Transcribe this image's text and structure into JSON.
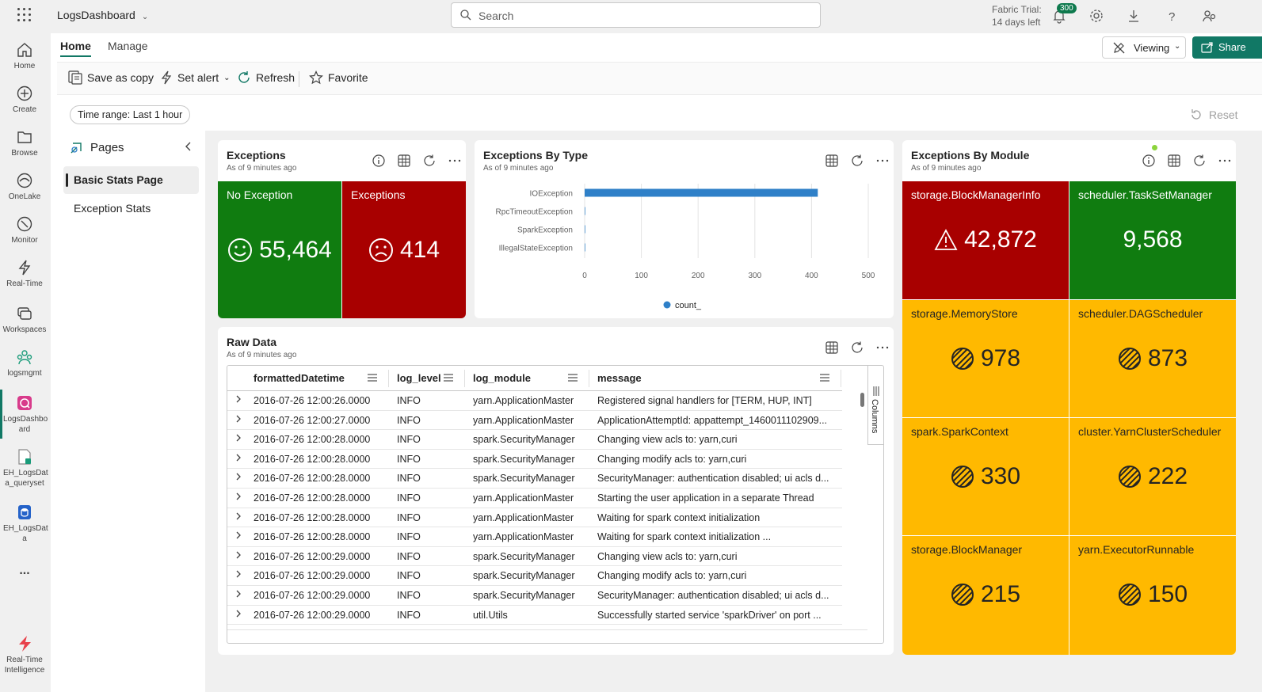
{
  "app": {
    "title": "LogsDashboard",
    "search_placeholder": "Search",
    "trial_line1": "Fabric Trial:",
    "trial_line2": "14 days left",
    "notifications_count": "300"
  },
  "rail": [
    {
      "label": "Home",
      "icon": "home-icon"
    },
    {
      "label": "Create",
      "icon": "create-icon"
    },
    {
      "label": "Browse",
      "icon": "browse-icon"
    },
    {
      "label": "OneLake",
      "icon": "onelake-icon"
    },
    {
      "label": "Monitor",
      "icon": "monitor-icon"
    },
    {
      "label": "Real-Time",
      "icon": "realtime-icon"
    },
    {
      "label": "Workspaces",
      "icon": "workspaces-icon"
    },
    {
      "label": "logsmgmt",
      "icon": "workspace-people-icon"
    },
    {
      "label": "LogsDashbo ard",
      "icon": "dashboard-icon"
    },
    {
      "label": "EH_LogsDat a_queryset",
      "icon": "queryset-icon"
    },
    {
      "label": "EH_LogsDat a",
      "icon": "database-icon"
    },
    {
      "label": "...",
      "icon": "more-icon"
    },
    {
      "label": "Real-Time Intelligence",
      "icon": "rti-icon"
    }
  ],
  "tabs": [
    {
      "label": "Home"
    },
    {
      "label": "Manage"
    }
  ],
  "header_buttons": {
    "viewing": "Viewing",
    "share": "Share"
  },
  "toolbar": {
    "save_as_copy": "Save as copy",
    "set_alert": "Set alert",
    "refresh": "Refresh",
    "favorite": "Favorite"
  },
  "filters": {
    "time_range_label": "Time range:",
    "time_range_value": "Last 1 hour",
    "reset": "Reset"
  },
  "pages_pane": {
    "title": "Pages",
    "items": [
      {
        "label": "Basic Stats Page",
        "active": true
      },
      {
        "label": "Exception Stats",
        "active": false
      }
    ]
  },
  "tiles": {
    "exceptions": {
      "title": "Exceptions",
      "subtitle": "As of 9 minutes ago",
      "stats": [
        {
          "name": "No Exception",
          "value": "55,464",
          "color": "#107c10",
          "icon": "smile-icon"
        },
        {
          "name": "Exceptions",
          "value": "414",
          "color": "#a80000",
          "icon": "frown-icon"
        }
      ]
    },
    "by_type": {
      "title": "Exceptions By Type",
      "subtitle": "As of 9 minutes ago"
    },
    "by_module": {
      "title": "Exceptions By Module",
      "subtitle": "As of 9 minutes ago",
      "stats": [
        {
          "name": "storage.BlockManagerInfo",
          "value": "42,872",
          "color": "#a80000",
          "icon": "warning-icon"
        },
        {
          "name": "scheduler.TaskSetManager",
          "value": "9,568",
          "color": "#107c10",
          "icon": ""
        },
        {
          "name": "storage.MemoryStore",
          "value": "978",
          "color": "#ffb900",
          "icon": "hatched-circle-icon"
        },
        {
          "name": "scheduler.DAGScheduler",
          "value": "873",
          "color": "#ffb900",
          "icon": "hatched-circle-icon"
        },
        {
          "name": "spark.SparkContext",
          "value": "330",
          "color": "#ffb900",
          "icon": "hatched-circle-icon"
        },
        {
          "name": "cluster.YarnClusterScheduler",
          "value": "222",
          "color": "#ffb900",
          "icon": "hatched-circle-icon"
        },
        {
          "name": "storage.BlockManager",
          "value": "215",
          "color": "#ffb900",
          "icon": "hatched-circle-icon"
        },
        {
          "name": "yarn.ExecutorRunnable",
          "value": "150",
          "color": "#ffb900",
          "icon": "hatched-circle-icon"
        }
      ]
    },
    "raw_data": {
      "title": "Raw Data",
      "subtitle": "As of 9 minutes ago",
      "columns_panel_label": "Columns",
      "columns": [
        "formattedDatetime",
        "log_level",
        "log_module",
        "message"
      ],
      "rows": [
        [
          "2016-07-26 12:00:26.0000",
          "INFO",
          "yarn.ApplicationMaster",
          "Registered signal handlers for [TERM, HUP, INT]"
        ],
        [
          "2016-07-26 12:00:27.0000",
          "INFO",
          "yarn.ApplicationMaster",
          "ApplicationAttemptId: appattempt_1460011102909..."
        ],
        [
          "2016-07-26 12:00:28.0000",
          "INFO",
          "spark.SecurityManager",
          "Changing view acls to: yarn,curi"
        ],
        [
          "2016-07-26 12:00:28.0000",
          "INFO",
          "spark.SecurityManager",
          "Changing modify acls to: yarn,curi"
        ],
        [
          "2016-07-26 12:00:28.0000",
          "INFO",
          "spark.SecurityManager",
          "SecurityManager: authentication disabled; ui acls d..."
        ],
        [
          "2016-07-26 12:00:28.0000",
          "INFO",
          "yarn.ApplicationMaster",
          "Starting the user application in a separate Thread"
        ],
        [
          "2016-07-26 12:00:28.0000",
          "INFO",
          "yarn.ApplicationMaster",
          "Waiting for spark context initialization"
        ],
        [
          "2016-07-26 12:00:28.0000",
          "INFO",
          "yarn.ApplicationMaster",
          "Waiting for spark context initialization ..."
        ],
        [
          "2016-07-26 12:00:29.0000",
          "INFO",
          "spark.SecurityManager",
          "Changing view acls to: yarn,curi"
        ],
        [
          "2016-07-26 12:00:29.0000",
          "INFO",
          "spark.SecurityManager",
          "Changing modify acls to: yarn,curi"
        ],
        [
          "2016-07-26 12:00:29.0000",
          "INFO",
          "spark.SecurityManager",
          "SecurityManager: authentication disabled; ui acls d..."
        ],
        [
          "2016-07-26 12:00:29.0000",
          "INFO",
          "util.Utils",
          "Successfully started service 'sparkDriver' on port ..."
        ]
      ]
    }
  },
  "chart_data": {
    "type": "bar",
    "orientation": "horizontal",
    "categories": [
      "IOException",
      "RpcTimeoutException",
      "SparkException",
      "IllegalStateException"
    ],
    "series": [
      {
        "name": "count_",
        "values": [
          411,
          1,
          1,
          1
        ],
        "color": "#2f80c8"
      }
    ],
    "xlim": [
      0,
      500
    ],
    "xticks": [
      0,
      100,
      200,
      300,
      400,
      500
    ],
    "grid": true,
    "legend_position": "bottom"
  },
  "colors": {
    "accent": "#117865",
    "green": "#107c10",
    "red": "#a80000",
    "amber": "#ffb900"
  }
}
